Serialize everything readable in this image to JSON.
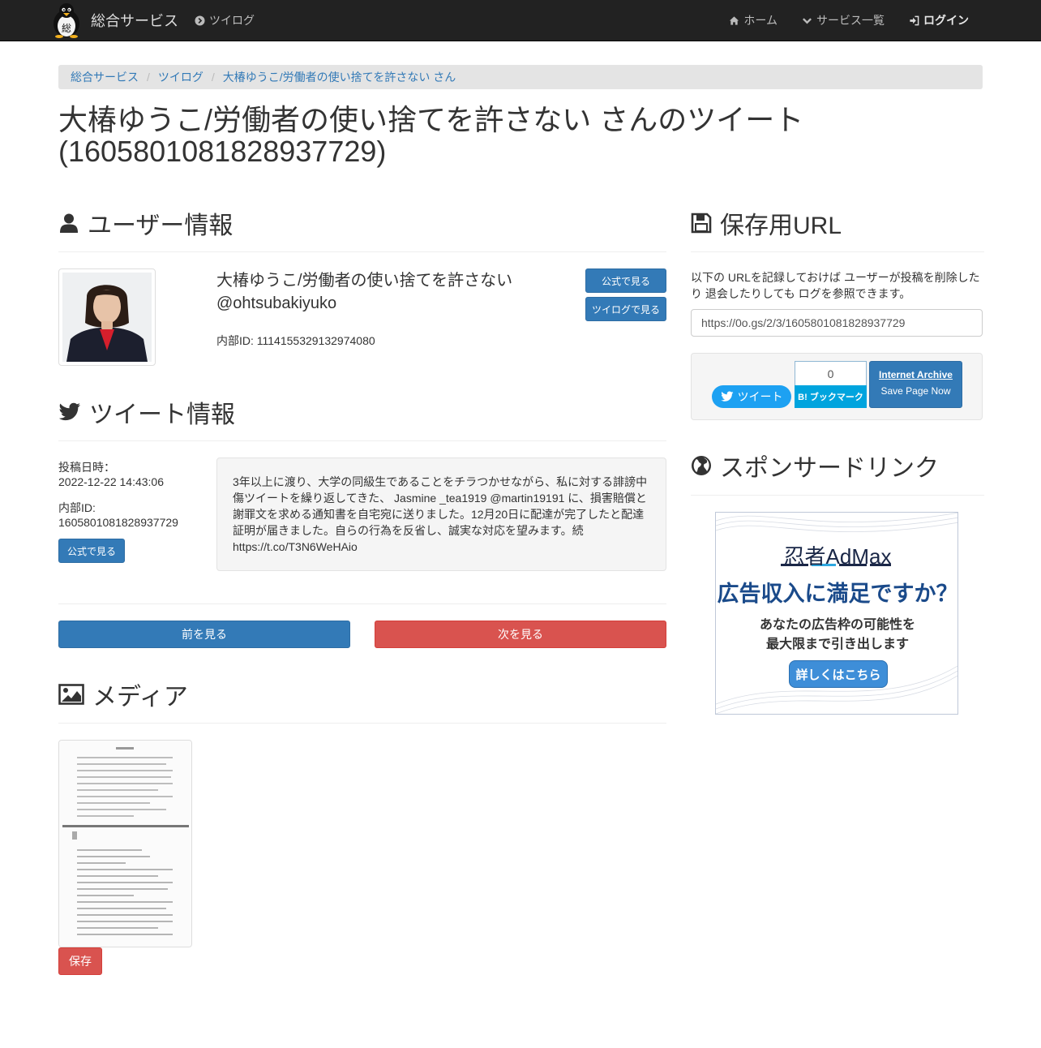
{
  "navbar": {
    "brand": "総合サービス",
    "left_link": "ツイログ",
    "items": [
      {
        "label": "ホーム"
      },
      {
        "label": "サービス一覧"
      },
      {
        "label": "ログイン"
      }
    ]
  },
  "breadcrumb": {
    "items": [
      "総合サービス",
      "ツイログ",
      "大椿ゆうこ/労働者の使い捨てを許さない さん"
    ]
  },
  "page_title": "大椿ゆうこ/労働者の使い捨てを許さない さんのツイート (1605801081828937729)",
  "user_section": {
    "heading": "ユーザー情報",
    "display_name": "大椿ゆうこ/労働者の使い捨てを許さない",
    "screen_name": "@ohtsubakiyuko",
    "internal_id": "内部ID: 1114155329132974080",
    "btn_official": "公式で見る",
    "btn_twilog": "ツイログで見る"
  },
  "tweet_section": {
    "heading": "ツイート情報",
    "posted_label": "投稿日時：",
    "posted_value": "2022-12-22 14:43:06",
    "id_label": "内部ID:",
    "id_value": "1605801081828937729",
    "btn_official": "公式で見る",
    "text": "3年以上に渡り、大学の同級生であることをチラつかせながら、私に対する誹謗中傷ツイートを繰り返してきた、 Jasmine _tea1919 @martin19191 に、損害賠償と謝罪文を求める通知書を自宅宛に送りました。12月20日に配達が完了したと配達証明が届きました。自らの行為を反省し、誠実な対応を望みます。続 https://t.co/T3N6WeHAio"
  },
  "nav_buttons": {
    "prev": "前を見る",
    "next": "次を見る"
  },
  "media_section": {
    "heading": "メディア",
    "save_button": "保存"
  },
  "save_url_section": {
    "heading": "保存用URL",
    "description": "以下の URLを記録しておけば ユーザーが投稿を削除したり 退会したりしても ログを参照できます。",
    "url": "https://0o.gs/2/3/1605801081828937729",
    "tweet_button": "ツイート",
    "hatena_count": "0",
    "hatena_button": "B! ブックマーク",
    "ia_title": "Internet Archive",
    "ia_sub": "Save Page Now"
  },
  "sponsor_section": {
    "heading": "スポンサードリンク",
    "ad_brand": "忍者AdMax",
    "ad_headline": "広告収入に満足ですか？",
    "ad_line1": "あなたの広告枠の可能性を",
    "ad_line2": "最大限まで引き出します",
    "ad_button": "詳しくはこちら"
  },
  "colors": {
    "navbar_bg": "#222222",
    "primary": "#337ab7",
    "danger": "#d9534f",
    "twitter": "#1da1f2",
    "hatena": "#00a4de"
  }
}
